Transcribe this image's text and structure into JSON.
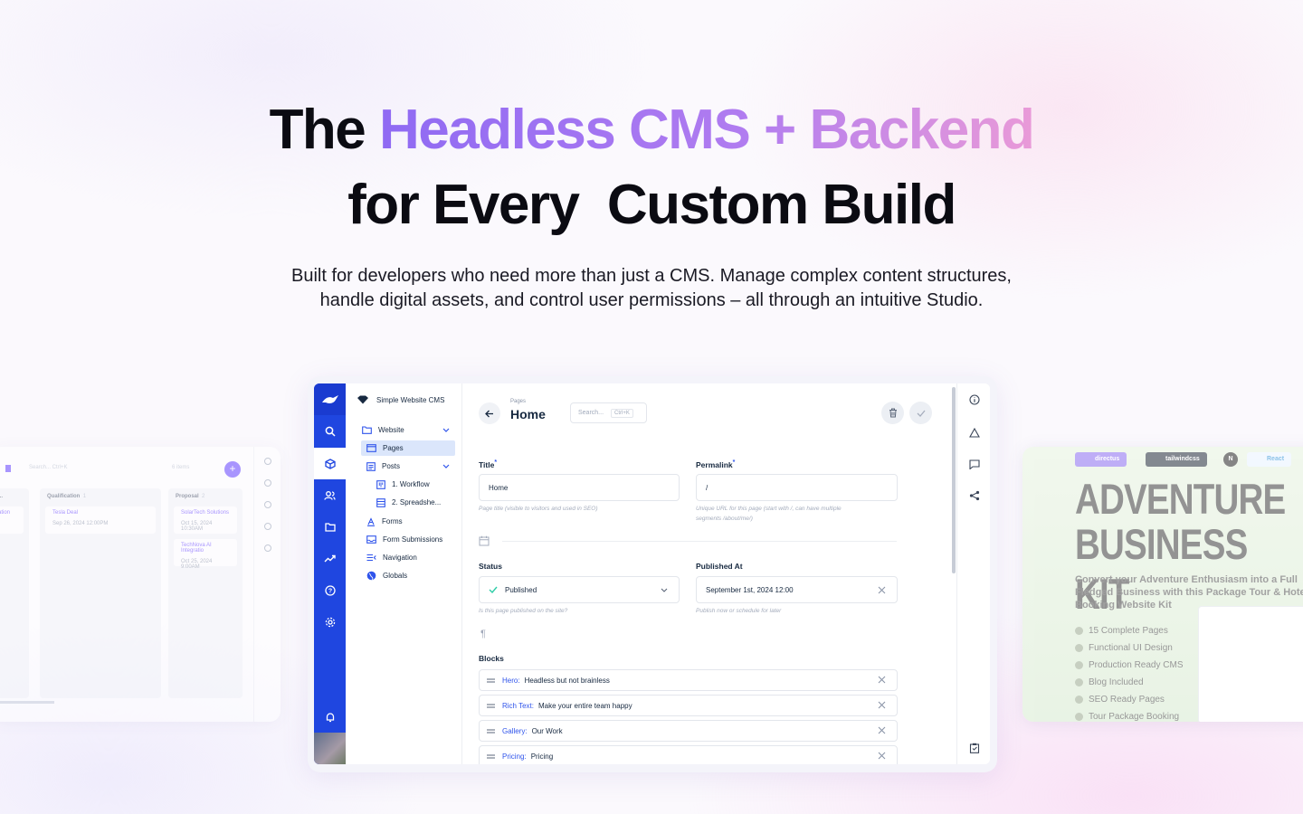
{
  "hero": {
    "line1_plain": "The",
    "line1_gradient": "Headless CMS + Backend",
    "line2": "for Every  Custom Build",
    "subtitle_line1": "Built for developers who need more than just a CMS. Manage complex content structures,",
    "subtitle_line2": "handle digital assets, and control user permissions – all through an intuitive Studio."
  },
  "colors": {
    "accent": "#1f46e0",
    "gradient_start": "#8f6af3",
    "gradient_end": "#e99ad8",
    "link_blue": "#2f54eb"
  },
  "left_preview": {
    "search": "Search...  Ctrl+K",
    "items_count": "6 items",
    "columns": [
      {
        "name": "ation",
        "count": "",
        "cards": [
          {
            "name": "",
            "date": ""
          }
        ]
      },
      {
        "name": "Qualification",
        "count": "1",
        "cards": [
          {
            "name": "Tesla Deal",
            "date": "Sep 26, 2024 12:00PM"
          }
        ]
      },
      {
        "name": "Proposal",
        "count": "2",
        "cards": [
          {
            "name": "SolarTech Solutions",
            "date": "Oct 15, 2024 10:30AM"
          },
          {
            "name": "TechNova AI Integratio",
            "date": "Oct 25, 2024 9:00AM"
          }
        ]
      }
    ]
  },
  "right_preview": {
    "badges": [
      "directus",
      "tailwindcss",
      "N",
      "React"
    ],
    "headline_1": "ADVENTURE",
    "headline_2": "BUSINESS KIT",
    "description": "Convert your Adventure Enthusiasm into a Full Fledged Business with this Package Tour & Hotel Booking Website Kit",
    "features": [
      "15 Complete Pages",
      "Functional UI Design",
      "Production Ready CMS",
      "Blog Included",
      "SEO Ready Pages",
      "Tour Package Booking"
    ]
  },
  "app": {
    "project_name": "Simple Website CMS",
    "rail_icons": [
      "directus-logo-icon",
      "search-icon",
      "content-cube-icon",
      "users-icon",
      "files-folder-icon",
      "insights-chart-icon",
      "help-icon",
      "settings-gear-icon",
      "notifications-bell-icon",
      "user-avatar"
    ],
    "nav": {
      "website": "Website",
      "pages": "Pages",
      "posts": "Posts",
      "workflow": "1. Workflow",
      "spreadsheet": "2. Spreadshe...",
      "forms": "Forms",
      "form_submissions": "Form Submissions",
      "navigation": "Navigation",
      "globals": "Globals"
    },
    "header": {
      "breadcrumb": "Pages",
      "title": "Home",
      "search_placeholder": "Search...",
      "search_shortcut": "Ctrl+K"
    },
    "form": {
      "title_label": "Title",
      "title_value": "Home",
      "title_hint": "Page title (visible to visitors and used in SEO)",
      "permalink_label": "Permalink",
      "permalink_value": "/",
      "permalink_hint_1": "Unique URL for this page (start with /, can have multiple",
      "permalink_hint_2": "segments /about/me/)",
      "status_label": "Status",
      "status_value": "Published",
      "status_hint": "Is this page published on the site?",
      "published_label": "Published At",
      "published_value": "September 1st, 2024 12:00",
      "published_hint": "Publish now or schedule for later",
      "blocks_label": "Blocks",
      "blocks": [
        {
          "type": "Hero:",
          "title": "Headless but not brainless"
        },
        {
          "type": "Rich Text:",
          "title": "Make your entire team happy"
        },
        {
          "type": "Gallery:",
          "title": "Our Work"
        },
        {
          "type": "Pricing:",
          "title": "Pricing"
        }
      ]
    },
    "sidebar_icons": [
      "info-icon",
      "revisions-triangle-icon",
      "comments-icon",
      "share-icon",
      "clipboard-icon"
    ]
  }
}
